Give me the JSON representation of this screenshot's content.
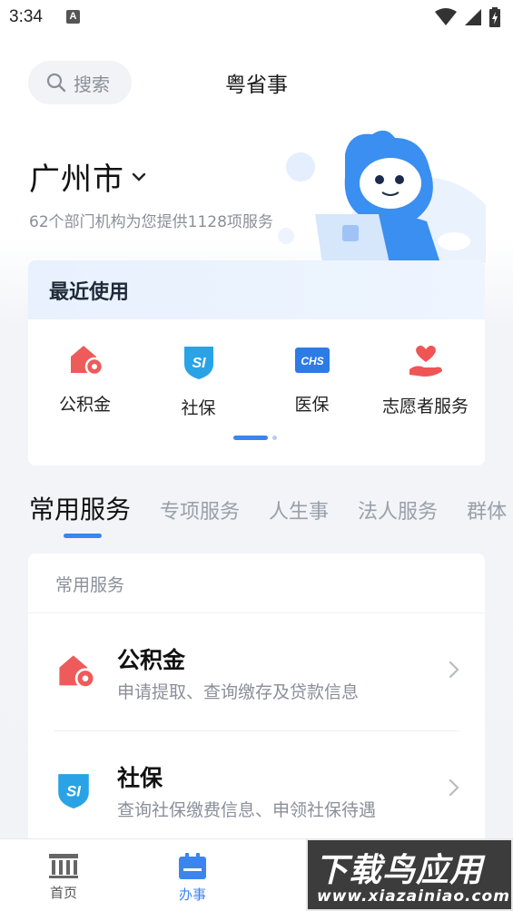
{
  "status_bar": {
    "time": "3:34",
    "notification_letter": "A"
  },
  "header": {
    "search_label": "搜索",
    "title": "粤省事"
  },
  "city": {
    "name": "广州市",
    "subtitle": "62个部门机构为您提供1128项服务"
  },
  "recent": {
    "title": "最近使用",
    "items": [
      {
        "label": "公积金",
        "icon": "housing-fund-icon"
      },
      {
        "label": "社保",
        "icon": "social-security-icon"
      },
      {
        "label": "医保",
        "icon": "medical-insurance-icon"
      },
      {
        "label": "志愿者服务",
        "icon": "volunteer-icon"
      }
    ],
    "carousel_page": 1,
    "carousel_pages": 2
  },
  "tabs": [
    "常用服务",
    "专项服务",
    "人生事",
    "法人服务",
    "群体"
  ],
  "services": {
    "card_title": "常用服务",
    "items": [
      {
        "name": "公积金",
        "desc": "申请提取、查询缴存及贷款信息",
        "icon": "housing-fund-icon"
      },
      {
        "name": "社保",
        "desc": "查询社保缴费信息、申领社保待遇",
        "icon": "social-security-icon"
      }
    ]
  },
  "bottom_nav": {
    "items": [
      "首页",
      "办事"
    ],
    "active": "办事"
  },
  "watermark": {
    "main": "下载鸟应用",
    "url": "www.xiazainiao.com"
  },
  "colors": {
    "accent": "#3a85f0",
    "housing_red": "#ee5b5b",
    "social_blue": "#29a3e6",
    "medical_blue": "#2d7be5",
    "volunteer_red": "#ef5555"
  }
}
